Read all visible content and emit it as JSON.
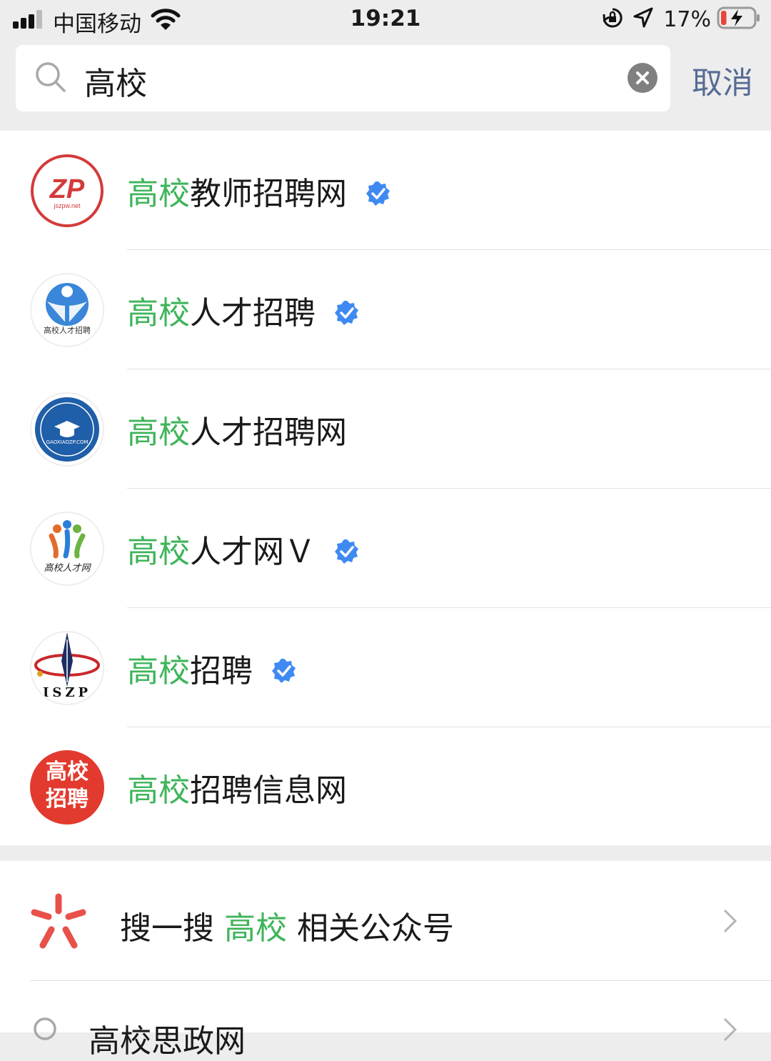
{
  "status_bar": {
    "carrier": "中国移动",
    "time": "19:21",
    "battery_percent": "17%",
    "battery_level": 0.17,
    "icons": [
      "signal-icon",
      "wifi-icon",
      "rotation-lock-icon",
      "location-icon",
      "battery-charging-icon"
    ]
  },
  "search": {
    "query": "高校",
    "cancel_label": "取消"
  },
  "results": [
    {
      "highlight": "高校",
      "rest": "教师招聘网",
      "verified": true,
      "avatar": "zp-logo"
    },
    {
      "highlight": "高校",
      "rest": "人才招聘",
      "verified": true,
      "avatar": "blue-person-logo",
      "avatar_text": "高校人才招聘"
    },
    {
      "highlight": "高校",
      "rest": "人才招聘网",
      "verified": false,
      "avatar": "blue-seal-logo",
      "avatar_text": "GAOXIAOZP.COM"
    },
    {
      "highlight": "高校",
      "rest": "人才网Ｖ",
      "verified": true,
      "avatar": "people-logo",
      "avatar_text": "高校人才网"
    },
    {
      "highlight": "高校",
      "rest": "招聘",
      "verified": true,
      "avatar": "pen-logo",
      "avatar_text": "ISZP"
    },
    {
      "highlight": "高校",
      "rest": "招聘信息网",
      "verified": false,
      "avatar": "red-circle-logo",
      "avatar_text": "高校招聘"
    }
  ],
  "sou_yi_sou": {
    "prefix": "搜一搜",
    "keyword": "高校",
    "suffix": "相关公众号"
  },
  "suggestion": {
    "text": "高校思政网"
  },
  "colors": {
    "highlight": "#3fb45a",
    "link": "#576b95",
    "verified": "#3f8af2"
  }
}
